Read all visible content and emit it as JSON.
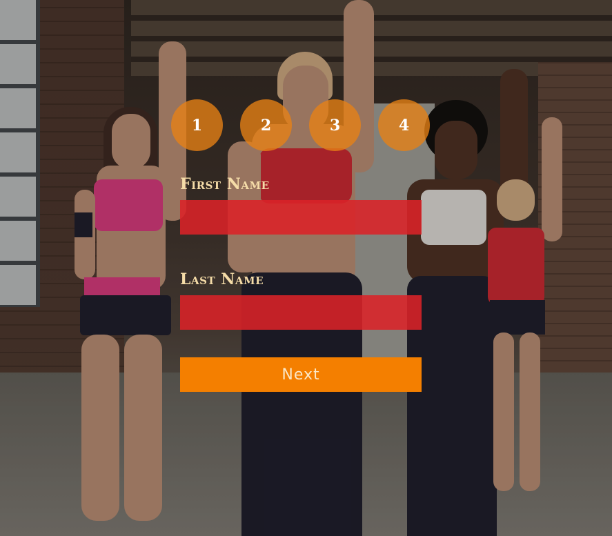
{
  "steps": [
    {
      "label": "1"
    },
    {
      "label": "2"
    },
    {
      "label": "3"
    },
    {
      "label": "4"
    }
  ],
  "form": {
    "first_name_label": "First Name",
    "first_name_value": "",
    "last_name_label": "Last Name",
    "last_name_value": "",
    "next_label": "Next"
  },
  "colors": {
    "step_circle": "#e88214",
    "input_bg": "#db2228",
    "next_button": "#f47f00",
    "label_text": "#f5dca8"
  }
}
